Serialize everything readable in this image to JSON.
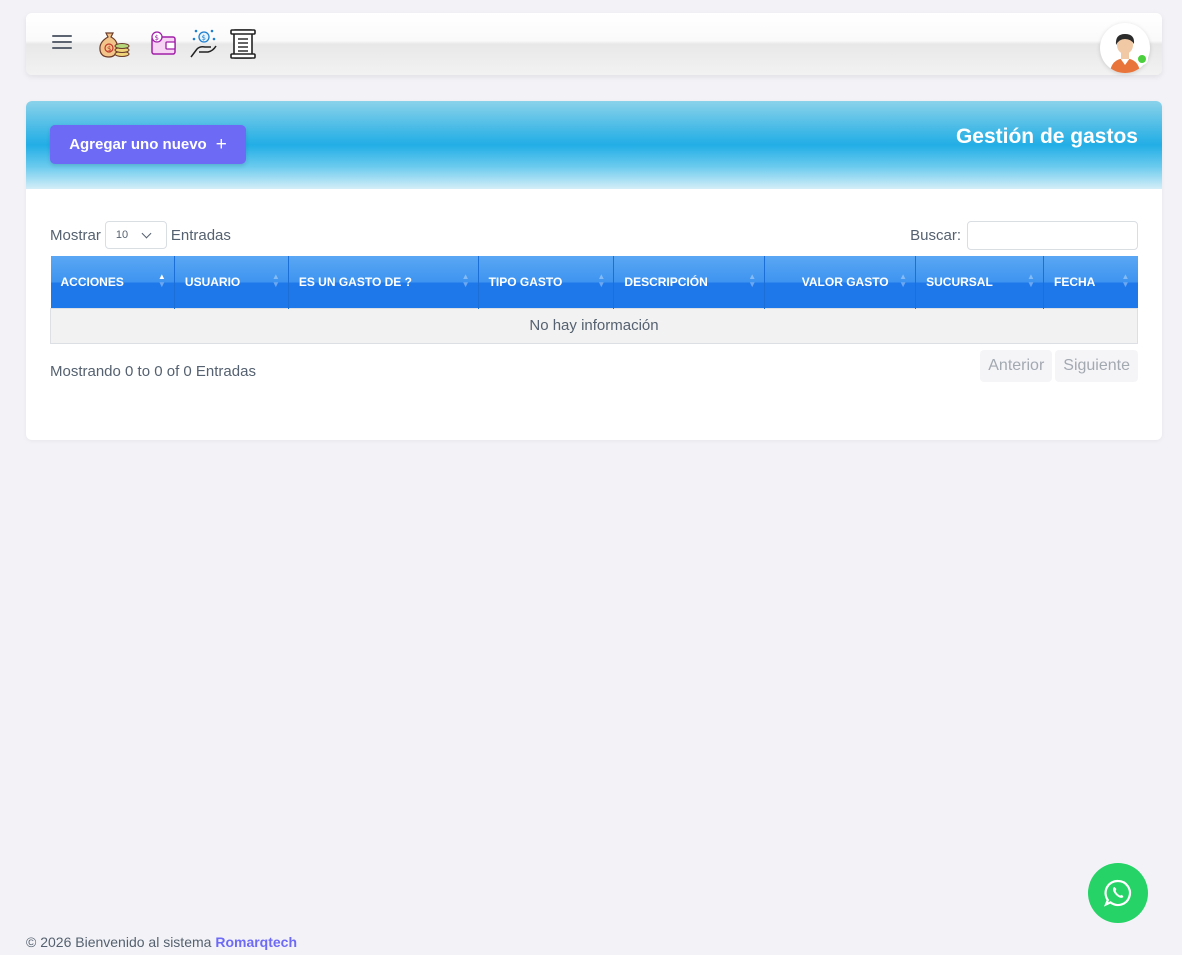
{
  "navbar": {
    "icons": [
      "money-bag-coins-icon",
      "wallet-icon",
      "hand-money-icon",
      "receipt-icon"
    ],
    "menu_icon": "hamburger-menu-icon",
    "avatar_icon": "user-avatar-icon",
    "status": "online"
  },
  "page": {
    "add_button_label": "Agregar uno nuevo",
    "title": "Gestión de gastos"
  },
  "table": {
    "length_label_before": "Mostrar",
    "length_value": "10",
    "length_label_after": "Entradas",
    "search_label": "Buscar:",
    "search_value": "",
    "columns": [
      "ACCIONES",
      "USUARIO",
      "ES UN GASTO DE ?",
      "TIPO GASTO",
      "DESCRIPCIÓN",
      "VALOR GASTO",
      "SUCURSAL",
      "FECHA"
    ],
    "empty_text": "No hay información",
    "info_text": "Mostrando 0 to 0 of 0 Entradas",
    "prev_label": "Anterior",
    "next_label": "Siguiente"
  },
  "footer": {
    "text": "© 2026 Bienvenido al sistema",
    "brand": "Romarqtech"
  },
  "colors": {
    "accent": "#6d6af6",
    "header_blue": "#22aee6",
    "table_head": "#1f78ea",
    "whatsapp": "#25d366"
  }
}
